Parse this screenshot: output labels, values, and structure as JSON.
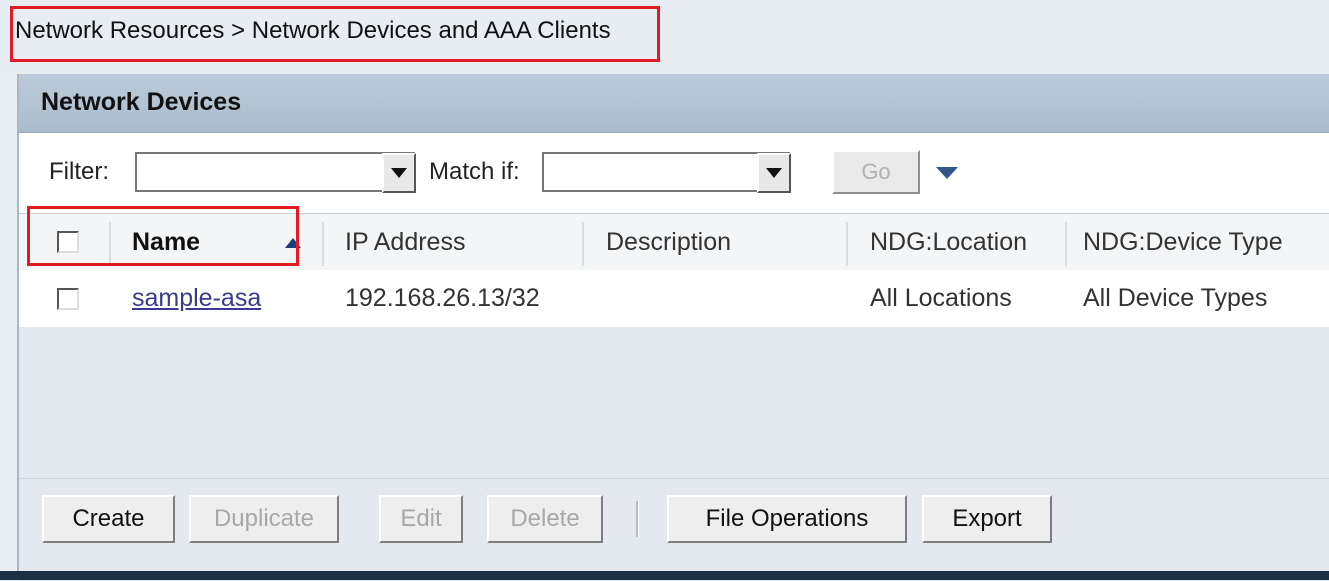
{
  "breadcrumb": "Network Resources > Network Devices and AAA Clients",
  "panel": {
    "title": "Network Devices"
  },
  "filter": {
    "filter_label": "Filter:",
    "filter_value": "",
    "match_label": "Match if:",
    "match_value": "",
    "go_label": "Go"
  },
  "table": {
    "columns": [
      {
        "label": "Name",
        "sorted": "ascending"
      },
      {
        "label": "IP Address"
      },
      {
        "label": "Description"
      },
      {
        "label": "NDG:Location"
      },
      {
        "label": "NDG:Device Type"
      }
    ],
    "rows": [
      {
        "name": "sample-asa",
        "ip": "192.168.26.13/32",
        "description": "",
        "location": "All Locations",
        "device_type": "All Device Types"
      }
    ]
  },
  "buttons": {
    "create": "Create",
    "duplicate": "Duplicate",
    "edit": "Edit",
    "delete": "Delete",
    "file_operations": "File Operations",
    "export": "Export"
  },
  "colors": {
    "highlight": "#e11b22",
    "header_bg": "#b3c4d4",
    "link": "#3b3a8f"
  }
}
